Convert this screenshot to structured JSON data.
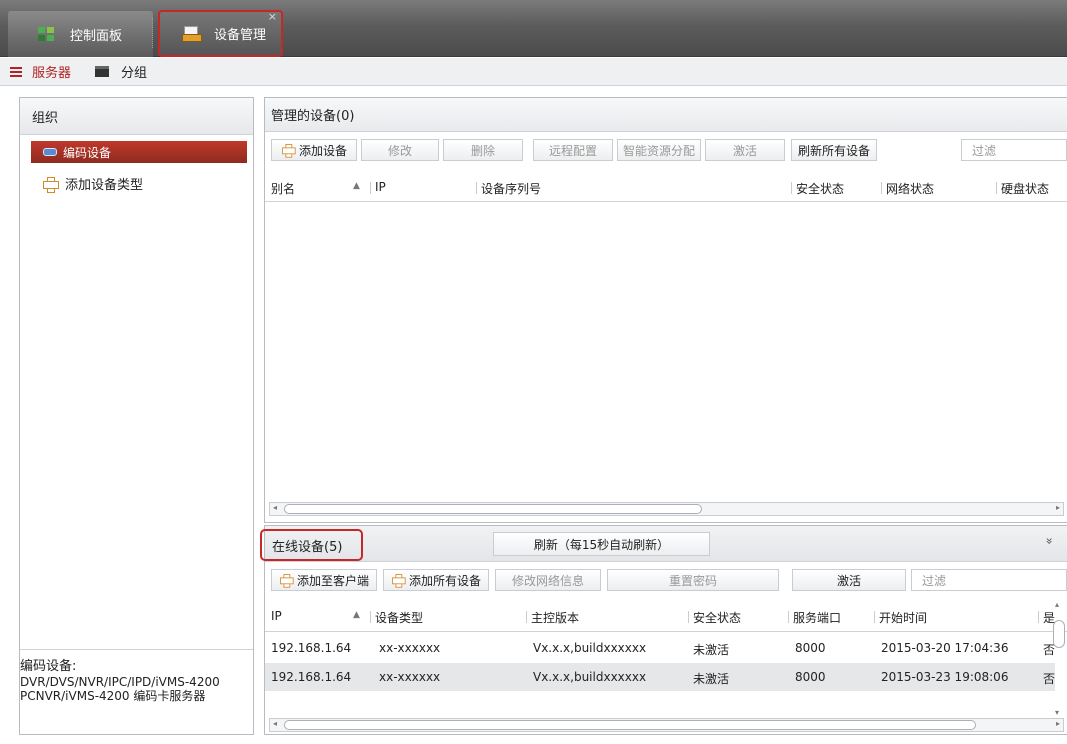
{
  "top_tabs": {
    "control_panel": "控制面板",
    "device_manager": "设备管理",
    "close_glyph": "×"
  },
  "sub_tabs": {
    "server": "服务器",
    "group": "分组"
  },
  "org_panel": {
    "title": "组织",
    "selected_item": "编码设备",
    "add_item": "添加设备类型",
    "footer": {
      "label": "编码设备:",
      "line1": "DVR/DVS/NVR/IPC/IPD/iVMS-4200",
      "line2": "PCNVR/iVMS-4200 编码卡服务器"
    }
  },
  "managed": {
    "title": "管理的设备(0)",
    "buttons": {
      "add": "添加设备",
      "modify": "修改",
      "delete": "删除",
      "remote_config": "远程配置",
      "smart_alloc": "智能资源分配",
      "activate": "激活",
      "refresh_all": "刷新所有设备"
    },
    "filter_placeholder": "过滤",
    "columns": {
      "alias": "别名",
      "ip": "IP",
      "serial": "设备序列号",
      "security": "安全状态",
      "network": "网络状态",
      "disk": "硬盘状态"
    }
  },
  "online": {
    "title": "在线设备(5)",
    "refresh": "刷新（每15秒自动刷新）",
    "collapse_glyph": "»",
    "buttons": {
      "add_to_client": "添加至客户端",
      "add_all": "添加所有设备",
      "modify_net": "修改网络信息",
      "reset_pwd": "重置密码",
      "activate": "激活"
    },
    "filter_placeholder": "过滤",
    "columns": {
      "ip": "IP",
      "type": "设备类型",
      "version": "主控版本",
      "security": "安全状态",
      "port": "服务端口",
      "start_time": "开始时间",
      "more": "是"
    },
    "rows": [
      {
        "ip": "192.168.1.64",
        "type": "xx-xxxxxx",
        "version": "Vx.x.x,buildxxxxxx",
        "security": "未激活",
        "port": "8000",
        "start_time": "2015-03-20 17:04:36",
        "more": "否"
      },
      {
        "ip": "192.168.1.64",
        "type": "xx-xxxxxx",
        "version": "Vx.x.x,buildxxxxxx",
        "security": "未激活",
        "port": "8000",
        "start_time": "2015-03-23 19:08:06",
        "more": "否"
      }
    ]
  }
}
